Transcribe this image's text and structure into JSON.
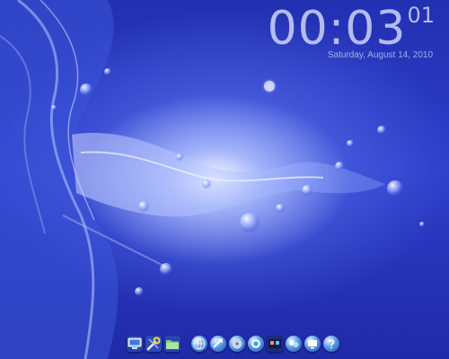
{
  "clock": {
    "time": "00:03",
    "seconds": "01",
    "date": "Saturday, August 14, 2010"
  },
  "dock": {
    "left_group": [
      "computer-icon",
      "tools-icon",
      "folder-icon"
    ],
    "right_group": [
      "web-browser-icon",
      "mail-icon",
      "music-player-icon",
      "network-icon",
      "media-player-icon",
      "chat-icon",
      "display-icon",
      "help-icon"
    ]
  },
  "colors": {
    "background": "#1d28a8",
    "highlight": "#e8eeff",
    "clock_text": "#d7deff"
  }
}
